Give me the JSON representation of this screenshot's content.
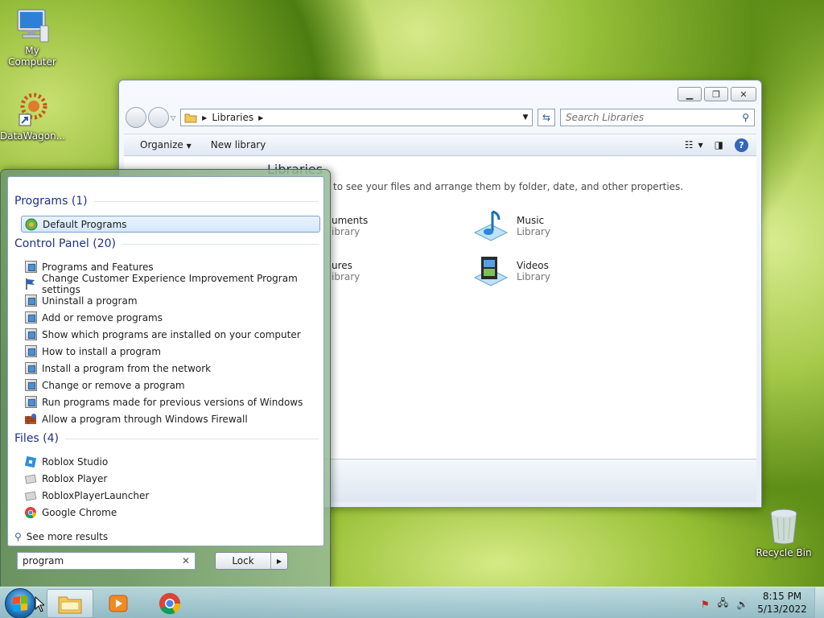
{
  "desktop": {
    "icons": [
      {
        "label": "My Computer",
        "icon": "computer-icon"
      },
      {
        "label": "DataWagon...",
        "icon": "datawagon-shortcut-icon"
      },
      {
        "label": "Recycle Bin",
        "icon": "recycle-bin-icon"
      }
    ]
  },
  "explorer": {
    "address": {
      "crumbs": [
        "Libraries"
      ]
    },
    "search_placeholder": "Search Libraries",
    "toolbar": {
      "organize": "Organize",
      "new_library": "New library"
    },
    "content": {
      "title": "Libraries",
      "description": "to see your files and arrange them by folder, date, and other properties.",
      "items": [
        {
          "name": "uments",
          "sub": "ibrary"
        },
        {
          "name": "Music",
          "sub": "Library"
        },
        {
          "name": "ures",
          "sub": "ibrary"
        },
        {
          "name": "Videos",
          "sub": "Library"
        }
      ]
    }
  },
  "start_menu": {
    "groups": {
      "programs": "Programs (1)",
      "control_panel": "Control Panel (20)",
      "files": "Files (4)"
    },
    "programs": [
      "Default Programs"
    ],
    "control_panel": [
      "Programs and Features",
      "Change Customer Experience Improvement Program settings",
      "Uninstall a program",
      "Add or remove programs",
      "Show which programs are installed on your computer",
      "How to install a program",
      "Install a program from the network",
      "Change or remove a program",
      "Run programs made for previous versions of Windows",
      "Allow a program through Windows Firewall"
    ],
    "files": [
      "Roblox Studio",
      "Roblox Player",
      "RobloxPlayerLauncher",
      "Google Chrome"
    ],
    "see_more": "See more results",
    "search_value": "program",
    "lock_label": "Lock"
  },
  "taskbar": {
    "time": "8:15 PM",
    "date": "5/13/2022"
  }
}
